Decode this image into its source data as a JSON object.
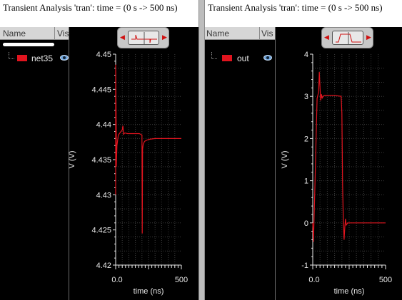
{
  "left_panel": {
    "title": "Transient Analysis 'tran': time = (0 s -> 500 ns)",
    "signal_list": {
      "col_name": "Name",
      "col_vis": "Vis",
      "signals": [
        {
          "name": "net35",
          "color": "#e0141e",
          "visible": true
        }
      ]
    }
  },
  "right_panel": {
    "title": "Transient Analysis 'tran': time = (0 s -> 500 ns)",
    "signal_list": {
      "col_name": "Name",
      "col_vis": "Vis",
      "signals": [
        {
          "name": "out",
          "color": "#e0141e",
          "visible": true
        }
      ]
    }
  },
  "chart_data": [
    {
      "type": "line",
      "xlabel": "time (ns)",
      "ylabel": "V (V)",
      "xlim": [
        0,
        500
      ],
      "ylim": [
        4.42,
        4.45
      ],
      "x_ticks": [
        "0.0",
        "500"
      ],
      "y_ticks": [
        "4.45",
        "4.445",
        "4.44",
        "4.435",
        "4.43",
        "4.425",
        "4.42"
      ],
      "y_tick_values": [
        4.45,
        4.445,
        4.44,
        4.435,
        4.43,
        4.425,
        4.42
      ],
      "grid": true,
      "series": [
        {
          "name": "net35",
          "color": "#e0141e",
          "x": [
            0,
            0,
            5,
            5,
            10,
            20,
            40,
            50,
            55,
            60,
            70,
            90,
            120,
            180,
            200,
            202,
            205,
            210,
            220,
            240,
            260,
            300,
            400,
            500
          ],
          "y": [
            4.43,
            4.4485,
            4.438,
            4.434,
            4.437,
            4.4385,
            4.439,
            4.4392,
            4.4398,
            4.4386,
            4.4388,
            4.4387,
            4.4387,
            4.4387,
            4.4385,
            4.4245,
            4.4365,
            4.4372,
            4.4376,
            4.4378,
            4.4379,
            4.438,
            4.438,
            4.438
          ]
        }
      ]
    },
    {
      "type": "line",
      "xlabel": "time (ns)",
      "ylabel": "V (V)",
      "xlim": [
        0,
        500
      ],
      "ylim": [
        -1,
        4
      ],
      "x_ticks": [
        "0.0",
        "500"
      ],
      "y_ticks": [
        "4",
        "3",
        "2",
        "1",
        "0",
        "-1"
      ],
      "y_tick_values": [
        4,
        3,
        2,
        1,
        0,
        -1
      ],
      "grid": true,
      "series": [
        {
          "name": "out",
          "color": "#e0141e",
          "x": [
            0,
            5,
            10,
            15,
            20,
            25,
            30,
            40,
            45,
            50,
            55,
            60,
            65,
            70,
            80,
            100,
            150,
            195,
            200,
            205,
            210,
            215,
            220,
            225,
            230,
            240,
            260,
            300,
            400,
            500
          ],
          "y": [
            0.0,
            -0.45,
            0.2,
            0.9,
            1.6,
            2.3,
            2.95,
            3.1,
            3.58,
            3.2,
            2.9,
            3.05,
            2.95,
            3.0,
            3.02,
            3.02,
            3.02,
            3.0,
            2.6,
            0.9,
            0.1,
            -0.4,
            -0.1,
            0.1,
            -0.05,
            0.0,
            0.0,
            0.0,
            0.0,
            0.0
          ]
        }
      ]
    }
  ]
}
